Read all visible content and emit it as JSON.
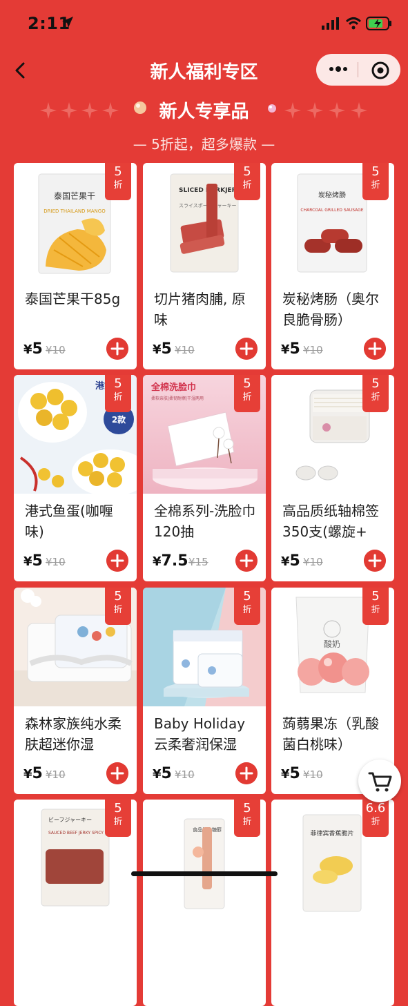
{
  "status_bar": {
    "time": "2:11"
  },
  "navbar": {
    "title": "新人福利专区"
  },
  "banner": {
    "title": "新人专享品",
    "subtitle": "— 5折起，超多爆款 —"
  },
  "products": [
    {
      "name": "泰国芒果干85g",
      "price": "5",
      "original": "¥10",
      "discount": "5",
      "discount_unit": "折",
      "image_text": [
        "泰国芒果干",
        "DRIED THAILAND MANGO"
      ]
    },
    {
      "name": "切片猪肉脯, 原味",
      "price": "5",
      "original": "¥10",
      "discount": "5",
      "discount_unit": "折",
      "image_text": [
        "SLICED PORKJERKY",
        "スライスポークジャーキー"
      ]
    },
    {
      "name": "炭秘烤肠（奥尔良脆骨肠）",
      "price": "5",
      "original": "¥10",
      "discount": "5",
      "discount_unit": "折",
      "image_text": [
        "炭秘烤肠",
        "CHARCOAL GRILLED SAUSAGE"
      ]
    },
    {
      "name": "港式鱼蛋(咖喱味)",
      "price": "5",
      "original": "¥10",
      "discount": "5",
      "discount_unit": "折",
      "image_text": [
        "港式",
        "2款"
      ]
    },
    {
      "name": "全棉系列-洗脸巾120抽",
      "price": "7.5",
      "original": "¥15",
      "discount": "5",
      "discount_unit": "折",
      "image_text": [
        "全棉洗脸巾",
        "柔软亲肤|柔韧耐擦|干湿两用"
      ]
    },
    {
      "name": "高品质纸轴棉签350支(螺旋+",
      "price": "5",
      "original": "¥10",
      "discount": "5",
      "discount_unit": "折",
      "image_text": []
    },
    {
      "name": "森林家族纯水柔肤超迷你湿",
      "price": "5",
      "original": "¥10",
      "discount": "5",
      "discount_unit": "折",
      "image_text": []
    },
    {
      "name": "Baby Holiday云柔奢润保湿",
      "price": "5",
      "original": "¥10",
      "discount": "5",
      "discount_unit": "折",
      "image_text": []
    },
    {
      "name": "蒟蒻果冻（乳酸菌白桃味）",
      "price": "5",
      "original": "¥10",
      "discount": "5",
      "discount_unit": "折",
      "image_text": [
        "酸奶"
      ]
    },
    {
      "name": "",
      "price": "",
      "original": "",
      "discount": "5",
      "discount_unit": "折",
      "image_text": [
        "ビーフジャーキー",
        "SAUCED BEEF JERKY SPICY FLAVOR"
      ]
    },
    {
      "name": "",
      "price": "",
      "original": "",
      "discount": "5",
      "discount_unit": "折",
      "image_text": [
        "食品级木糖醇"
      ]
    },
    {
      "name": "",
      "price": "",
      "original": "",
      "discount": "6.6",
      "discount_unit": "折",
      "image_text": [
        "菲律宾香蕉脆片"
      ]
    }
  ],
  "colors": {
    "background": "#e43b36",
    "accent": "#e23a33",
    "card": "#ffffff"
  },
  "icons": [
    "back-arrow-icon",
    "more-dots-icon",
    "close-target-icon",
    "plus-icon",
    "cart-icon",
    "star-icon"
  ]
}
